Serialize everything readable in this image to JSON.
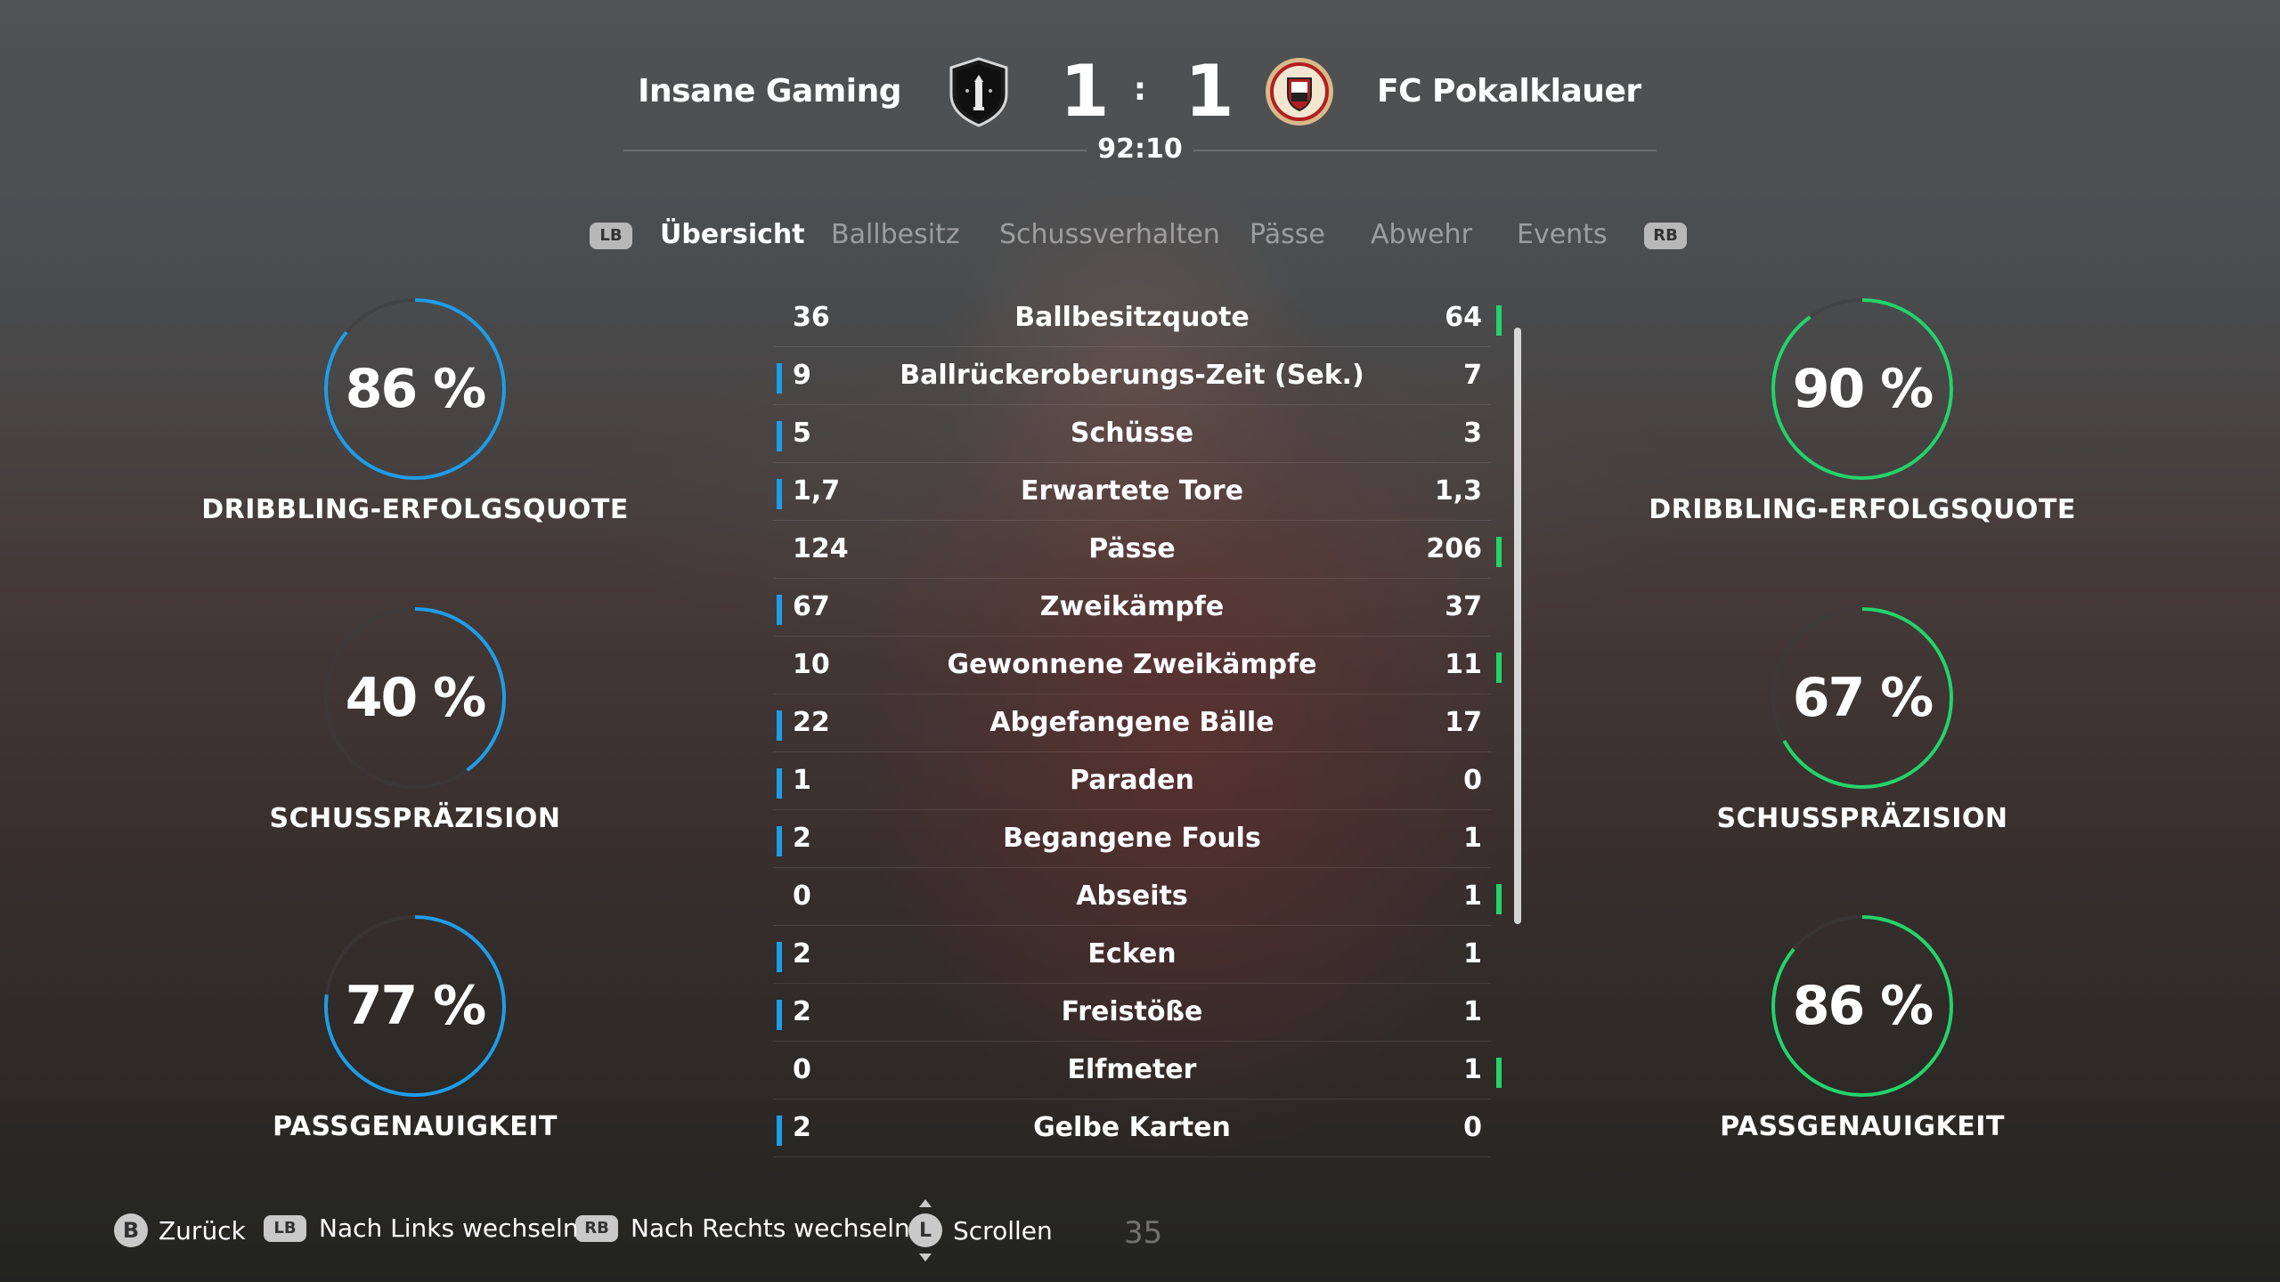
{
  "header": {
    "home_team": "Insane Gaming",
    "away_team": "FC Pokalklauer",
    "home_score": "1",
    "away_score": "1",
    "separator": ":",
    "match_clock": "92:10"
  },
  "tabs": {
    "left_shoulder": "LB",
    "right_shoulder": "RB",
    "items": [
      {
        "label": "Übersicht",
        "active": true
      },
      {
        "label": "Ballbesitz",
        "active": false
      },
      {
        "label": "Schussverhalten",
        "active": false
      },
      {
        "label": "Pässe",
        "active": false
      },
      {
        "label": "Abwehr",
        "active": false
      },
      {
        "label": "Events",
        "active": false
      }
    ]
  },
  "home_rings": [
    {
      "value": "86 %",
      "percent": 86,
      "label": "DRIBBLING-ERFOLGSQUOTE"
    },
    {
      "value": "40 %",
      "percent": 40,
      "label": "SCHUSSPRÄZISION"
    },
    {
      "value": "77 %",
      "percent": 77,
      "label": "PASSGENAUIGKEIT"
    }
  ],
  "away_rings": [
    {
      "value": "90 %",
      "percent": 90,
      "label": "DRIBBLING-ERFOLGSQUOTE"
    },
    {
      "value": "67 %",
      "percent": 67,
      "label": "SCHUSSPRÄZISION"
    },
    {
      "value": "86 %",
      "percent": 86,
      "label": "PASSGENAUIGKEIT"
    }
  ],
  "stats": [
    {
      "home": "36",
      "name": "Ballbesitzquote",
      "away": "64",
      "lead": "away"
    },
    {
      "home": "9",
      "name": "Ballrückeroberungs-Zeit (Sek.)",
      "away": "7",
      "lead": "home"
    },
    {
      "home": "5",
      "name": "Schüsse",
      "away": "3",
      "lead": "home"
    },
    {
      "home": "1,7",
      "name": "Erwartete Tore",
      "away": "1,3",
      "lead": "home"
    },
    {
      "home": "124",
      "name": "Pässe",
      "away": "206",
      "lead": "away"
    },
    {
      "home": "67",
      "name": "Zweikämpfe",
      "away": "37",
      "lead": "home"
    },
    {
      "home": "10",
      "name": "Gewonnene Zweikämpfe",
      "away": "11",
      "lead": "away"
    },
    {
      "home": "22",
      "name": "Abgefangene Bälle",
      "away": "17",
      "lead": "home"
    },
    {
      "home": "1",
      "name": "Paraden",
      "away": "0",
      "lead": "home"
    },
    {
      "home": "2",
      "name": "Begangene Fouls",
      "away": "1",
      "lead": "home"
    },
    {
      "home": "0",
      "name": "Abseits",
      "away": "1",
      "lead": "away"
    },
    {
      "home": "2",
      "name": "Ecken",
      "away": "1",
      "lead": "home"
    },
    {
      "home": "2",
      "name": "Freistöße",
      "away": "1",
      "lead": "home"
    },
    {
      "home": "0",
      "name": "Elfmeter",
      "away": "1",
      "lead": "away"
    },
    {
      "home": "2",
      "name": "Gelbe Karten",
      "away": "0",
      "lead": "home"
    }
  ],
  "footer": {
    "back_glyph": "B",
    "back_label": "Zurück",
    "left_glyph": "LB",
    "left_label": "Nach Links wechseln",
    "right_glyph": "RB",
    "right_label": "Nach Rechts wechseln",
    "scroll_glyph": "L",
    "scroll_label": "Scrollen",
    "number": "35"
  },
  "colors": {
    "home_accent": "#1e9de8",
    "away_accent": "#22d46a",
    "ring_track": "rgba(60,60,60,0.55)"
  },
  "icons": {
    "home_crest": "lighthouse-shield-crest-icon",
    "away_crest": "round-football-club-crest-icon"
  }
}
